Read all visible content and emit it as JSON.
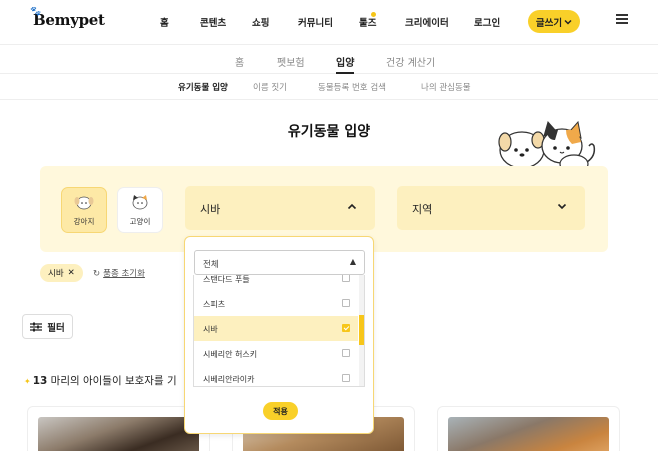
{
  "header": {
    "logo": "Bemypet",
    "nav": [
      "홈",
      "콘텐츠",
      "쇼핑",
      "커뮤니티",
      "툴즈",
      "크리에이터",
      "로그인"
    ],
    "write_button": "글쓰기"
  },
  "tabs": [
    "홈",
    "펫보험",
    "입양",
    "건강 계산기"
  ],
  "active_tab": "입양",
  "subtabs": [
    "유기동물 입양",
    "이름 짓기",
    "동물등록 번호 검색",
    "나의 관심동물"
  ],
  "active_subtab": "유기동물 입양",
  "page_title": "유기동물 입양",
  "filters": {
    "animal_types": [
      {
        "label": "강아지",
        "active": true
      },
      {
        "label": "고양이",
        "active": false
      }
    ],
    "breed_select": {
      "value": "시바"
    },
    "region_select": {
      "value": "지역"
    },
    "dropdown": {
      "search_value": "전체",
      "options": [
        {
          "label": "스탠다드 푸들",
          "checked": false
        },
        {
          "label": "스피츠",
          "checked": false
        },
        {
          "label": "시바",
          "checked": true
        },
        {
          "label": "시베리안 허스키",
          "checked": false
        },
        {
          "label": "시베리안라이카",
          "checked": false
        }
      ],
      "apply_label": "적용"
    }
  },
  "selected_chip": "시바",
  "reset_label": "품종 초기화",
  "filter_button": "필터",
  "result": {
    "count": "13",
    "text_suffix": "마리의 아이들이 보호자를 기"
  },
  "colors": {
    "accent": "#f9d029",
    "panel_bg": "#fff8dc",
    "select_bg": "#fdf0bf"
  }
}
